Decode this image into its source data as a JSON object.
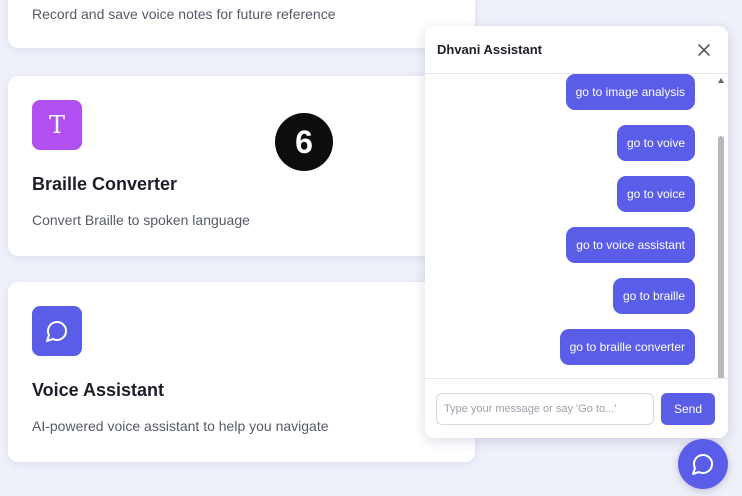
{
  "cards": {
    "voice_notes": {
      "description": "Record and save voice notes for future reference"
    },
    "braille": {
      "icon": "text-t-icon",
      "icon_letter": "T",
      "title": "Braille Converter",
      "description": "Convert Braille to spoken language"
    },
    "voice_assistant": {
      "icon": "chat-bubble-icon",
      "title": "Voice Assistant",
      "description": "AI-powered voice assistant to help you navigate"
    }
  },
  "step_badge": "6",
  "chat": {
    "title": "Dhvani Assistant",
    "close_icon": "close-icon",
    "messages": [
      "go to image analysis",
      "go to voive",
      "go to voice",
      "go to voice assistant",
      "go to braille",
      "go to braille converter"
    ],
    "input": {
      "placeholder": "Type your message or say 'Go to...'",
      "value": ""
    },
    "send_label": "Send"
  },
  "fab_icon": "chat-bubble-icon",
  "colors": {
    "accent": "#5a5de8",
    "braille_icon_bg": "#b24ff0",
    "page_bg": "#eef0fa"
  }
}
